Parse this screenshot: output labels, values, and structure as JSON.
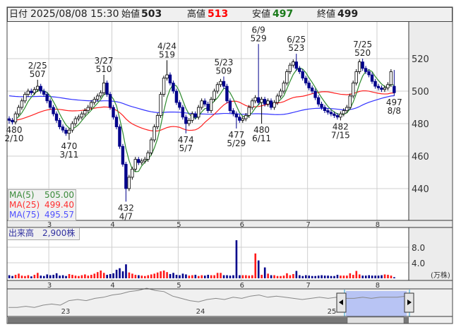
{
  "header": {
    "date_label": "日付",
    "datetime": "2025/08/08 15:30",
    "open_label": "始値",
    "open": "503",
    "high_label": "高値",
    "high": "513",
    "low_label": "安値",
    "low": "497",
    "close_label": "終値",
    "close": "499"
  },
  "legend": [
    {
      "name": "MA(5)",
      "value": "505.00",
      "color": "#3a8a3a"
    },
    {
      "name": "MA(25)",
      "value": "499.40",
      "color": "#ff3030"
    },
    {
      "name": "MA(75)",
      "value": "495.57",
      "color": "#5050ff"
    }
  ],
  "volume_label": "出来高　2,900株",
  "volume_unit": "(万株)",
  "colors": {
    "up_body": "#ffffff",
    "down_body": "#00008b",
    "vol_up": "#ff1a1a",
    "vol_down": "#00008b",
    "vol_flat": "#909090"
  },
  "chart_data": {
    "type": "candlestick",
    "price_ticks": [
      "440",
      "460",
      "480",
      "500",
      "520"
    ],
    "volume_ticks": [
      "4.0",
      "8.0"
    ],
    "months": [
      {
        "label": "3",
        "index": 13
      },
      {
        "label": "4",
        "index": 33
      },
      {
        "label": "5",
        "index": 54
      },
      {
        "label": "6",
        "index": 74
      },
      {
        "label": "7",
        "index": 95
      },
      {
        "label": "8",
        "index": 117
      }
    ],
    "closes": [
      482,
      481,
      486,
      490,
      494,
      498,
      500,
      499,
      501,
      503,
      500,
      498,
      494,
      490,
      486,
      482,
      478,
      476,
      474,
      476,
      480,
      483,
      484,
      486,
      488,
      490,
      493,
      495,
      497,
      499,
      505,
      498,
      490,
      484,
      478,
      466,
      455,
      440,
      447,
      452,
      458,
      456,
      457,
      458,
      462,
      470,
      478,
      485,
      498,
      508,
      510,
      505,
      500,
      493,
      490,
      484,
      480,
      482,
      486,
      484,
      490,
      494,
      492,
      488,
      495,
      500,
      504,
      506,
      503,
      494,
      488,
      486,
      484,
      482,
      483,
      485,
      490,
      494,
      496,
      493,
      495,
      492,
      494,
      490,
      493,
      497,
      500,
      505,
      512,
      516,
      518,
      514,
      512,
      508,
      505,
      502,
      500,
      496,
      492,
      490,
      488,
      487,
      486,
      485,
      484,
      486,
      488,
      490,
      497,
      505,
      512,
      518,
      514,
      512,
      510,
      506,
      503,
      502,
      501,
      502,
      504,
      512,
      499
    ],
    "last_ohlc": [
      503,
      513,
      497,
      499
    ],
    "volumes": [
      0.8,
      0.6,
      0.9,
      1.2,
      0.7,
      0.6,
      0.8,
      0.5,
      0.9,
      1.4,
      0.7,
      0.6,
      1.0,
      0.8,
      0.9,
      1.3,
      0.7,
      0.8,
      0.6,
      1.1,
      0.9,
      0.7,
      0.6,
      0.8,
      1.0,
      0.7,
      0.9,
      1.2,
      1.6,
      2.0,
      1.4,
      0.9,
      1.1,
      1.3,
      2.2,
      2.6,
      1.8,
      3.6,
      1.5,
      1.2,
      0.9,
      0.8,
      0.7,
      0.6,
      0.8,
      1.0,
      1.2,
      1.5,
      1.8,
      2.0,
      1.6,
      1.1,
      1.4,
      0.9,
      0.8,
      1.2,
      1.0,
      0.7,
      0.8,
      0.9,
      0.6,
      0.8,
      0.7,
      0.9,
      0.8,
      0.8,
      1.4,
      1.4,
      0.8,
      0.8,
      0.7,
      0.8,
      9.8,
      0.8,
      0.8,
      0.8,
      0.7,
      0.8,
      6.4,
      4.6,
      0.9,
      2.8,
      1.2,
      0.8,
      0.8,
      0.6,
      0.6,
      0.7,
      1.3,
      0.8,
      1.1,
      1.9,
      0.8,
      0.6,
      0.8,
      0.7,
      0.6,
      0.6,
      0.7,
      0.8,
      0.7,
      0.7,
      0.6,
      0.6,
      0.9,
      0.7,
      0.7,
      0.7,
      1.3,
      0.9,
      1.9,
      1.0,
      0.7,
      0.7,
      0.8,
      0.7,
      0.7,
      0.7,
      0.8,
      1.0,
      0.9,
      0.7,
      0.29
    ],
    "annotations": [
      {
        "index": 0,
        "type": "low",
        "price": 480,
        "date": "2/10",
        "text": "480"
      },
      {
        "index": 9,
        "type": "high",
        "price": 507,
        "date": "2/25",
        "text": "507"
      },
      {
        "index": 19,
        "type": "low",
        "price": 470,
        "date": "3/11",
        "text": "470"
      },
      {
        "index": 30,
        "type": "high",
        "price": 510,
        "date": "3/27",
        "text": "510"
      },
      {
        "index": 37,
        "type": "low",
        "price": 432,
        "date": "4/7",
        "text": "432"
      },
      {
        "index": 50,
        "type": "high",
        "price": 519,
        "date": "4/24",
        "text": "519"
      },
      {
        "index": 56,
        "type": "low",
        "price": 474,
        "date": "5/7",
        "text": "474"
      },
      {
        "index": 68,
        "type": "high",
        "price": 509,
        "date": "5/23",
        "text": "509"
      },
      {
        "index": 72,
        "type": "low",
        "price": 477,
        "date": "5/29",
        "text": "477"
      },
      {
        "index": 79,
        "type": "high",
        "price": 529,
        "date": "6/9",
        "text": "529"
      },
      {
        "index": 80,
        "type": "low",
        "price": 480,
        "date": "6/11",
        "text": "480"
      },
      {
        "index": 91,
        "type": "high",
        "price": 523,
        "date": "6/25",
        "text": "523"
      },
      {
        "index": 105,
        "type": "low",
        "price": 482,
        "date": "7/15",
        "text": "482"
      },
      {
        "index": 112,
        "type": "high",
        "price": 520,
        "date": "7/25",
        "text": "520"
      },
      {
        "index": 122,
        "type": "low",
        "price": 497,
        "date": "8/8",
        "text": "497"
      }
    ],
    "navigator": {
      "year_labels": [
        "23",
        "24",
        "25"
      ],
      "series": [
        488,
        488,
        489,
        488,
        490,
        491,
        490,
        494,
        495,
        494,
        496,
        497,
        499,
        500,
        502,
        503,
        505,
        503,
        502,
        498,
        496,
        494,
        493,
        495,
        496,
        495,
        497,
        496,
        498,
        499,
        497,
        498,
        497,
        496,
        495,
        496,
        497,
        496,
        497,
        496,
        496,
        497,
        496,
        497,
        497,
        497,
        498
      ]
    }
  }
}
